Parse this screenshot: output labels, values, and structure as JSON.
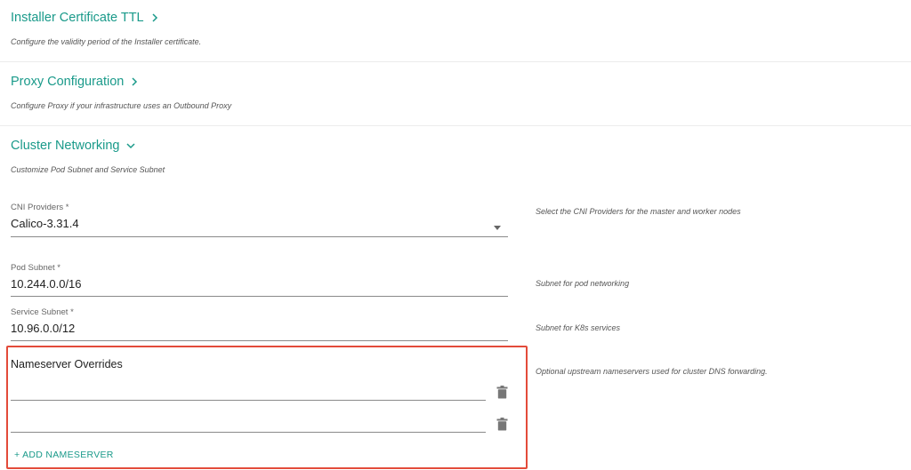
{
  "sections": {
    "installer_ttl": {
      "title": "Installer Certificate TTL",
      "desc": "Configure the validity period of the Installer certificate.",
      "chevron": "chevron-right-icon"
    },
    "proxy": {
      "title": "Proxy Configuration",
      "desc": "Configure Proxy if your infrastructure uses an Outbound Proxy",
      "chevron": "chevron-right-icon"
    },
    "cluster_networking": {
      "title": "Cluster Networking",
      "desc": "Customize Pod Subnet and Service Subnet",
      "chevron": "chevron-down-icon"
    }
  },
  "fields": {
    "cni": {
      "label": "CNI Providers *",
      "value": "Calico-3.31.4",
      "help": "Select the CNI Providers for the master and worker nodes"
    },
    "pod_subnet": {
      "label": "Pod Subnet *",
      "value": "10.244.0.0/16",
      "help": "Subnet for pod networking"
    },
    "service_subnet": {
      "label": "Service Subnet *",
      "value": "10.96.0.0/12",
      "help": "Subnet for K8s services"
    }
  },
  "nameservers": {
    "title": "Nameserver Overrides",
    "help": "Optional upstream nameservers used for cluster DNS forwarding.",
    "entries": [
      "",
      ""
    ],
    "add_label": "+ ADD  NAMESERVER"
  },
  "colors": {
    "accent": "#1a9a8a",
    "highlight_border": "#e34b3a"
  }
}
